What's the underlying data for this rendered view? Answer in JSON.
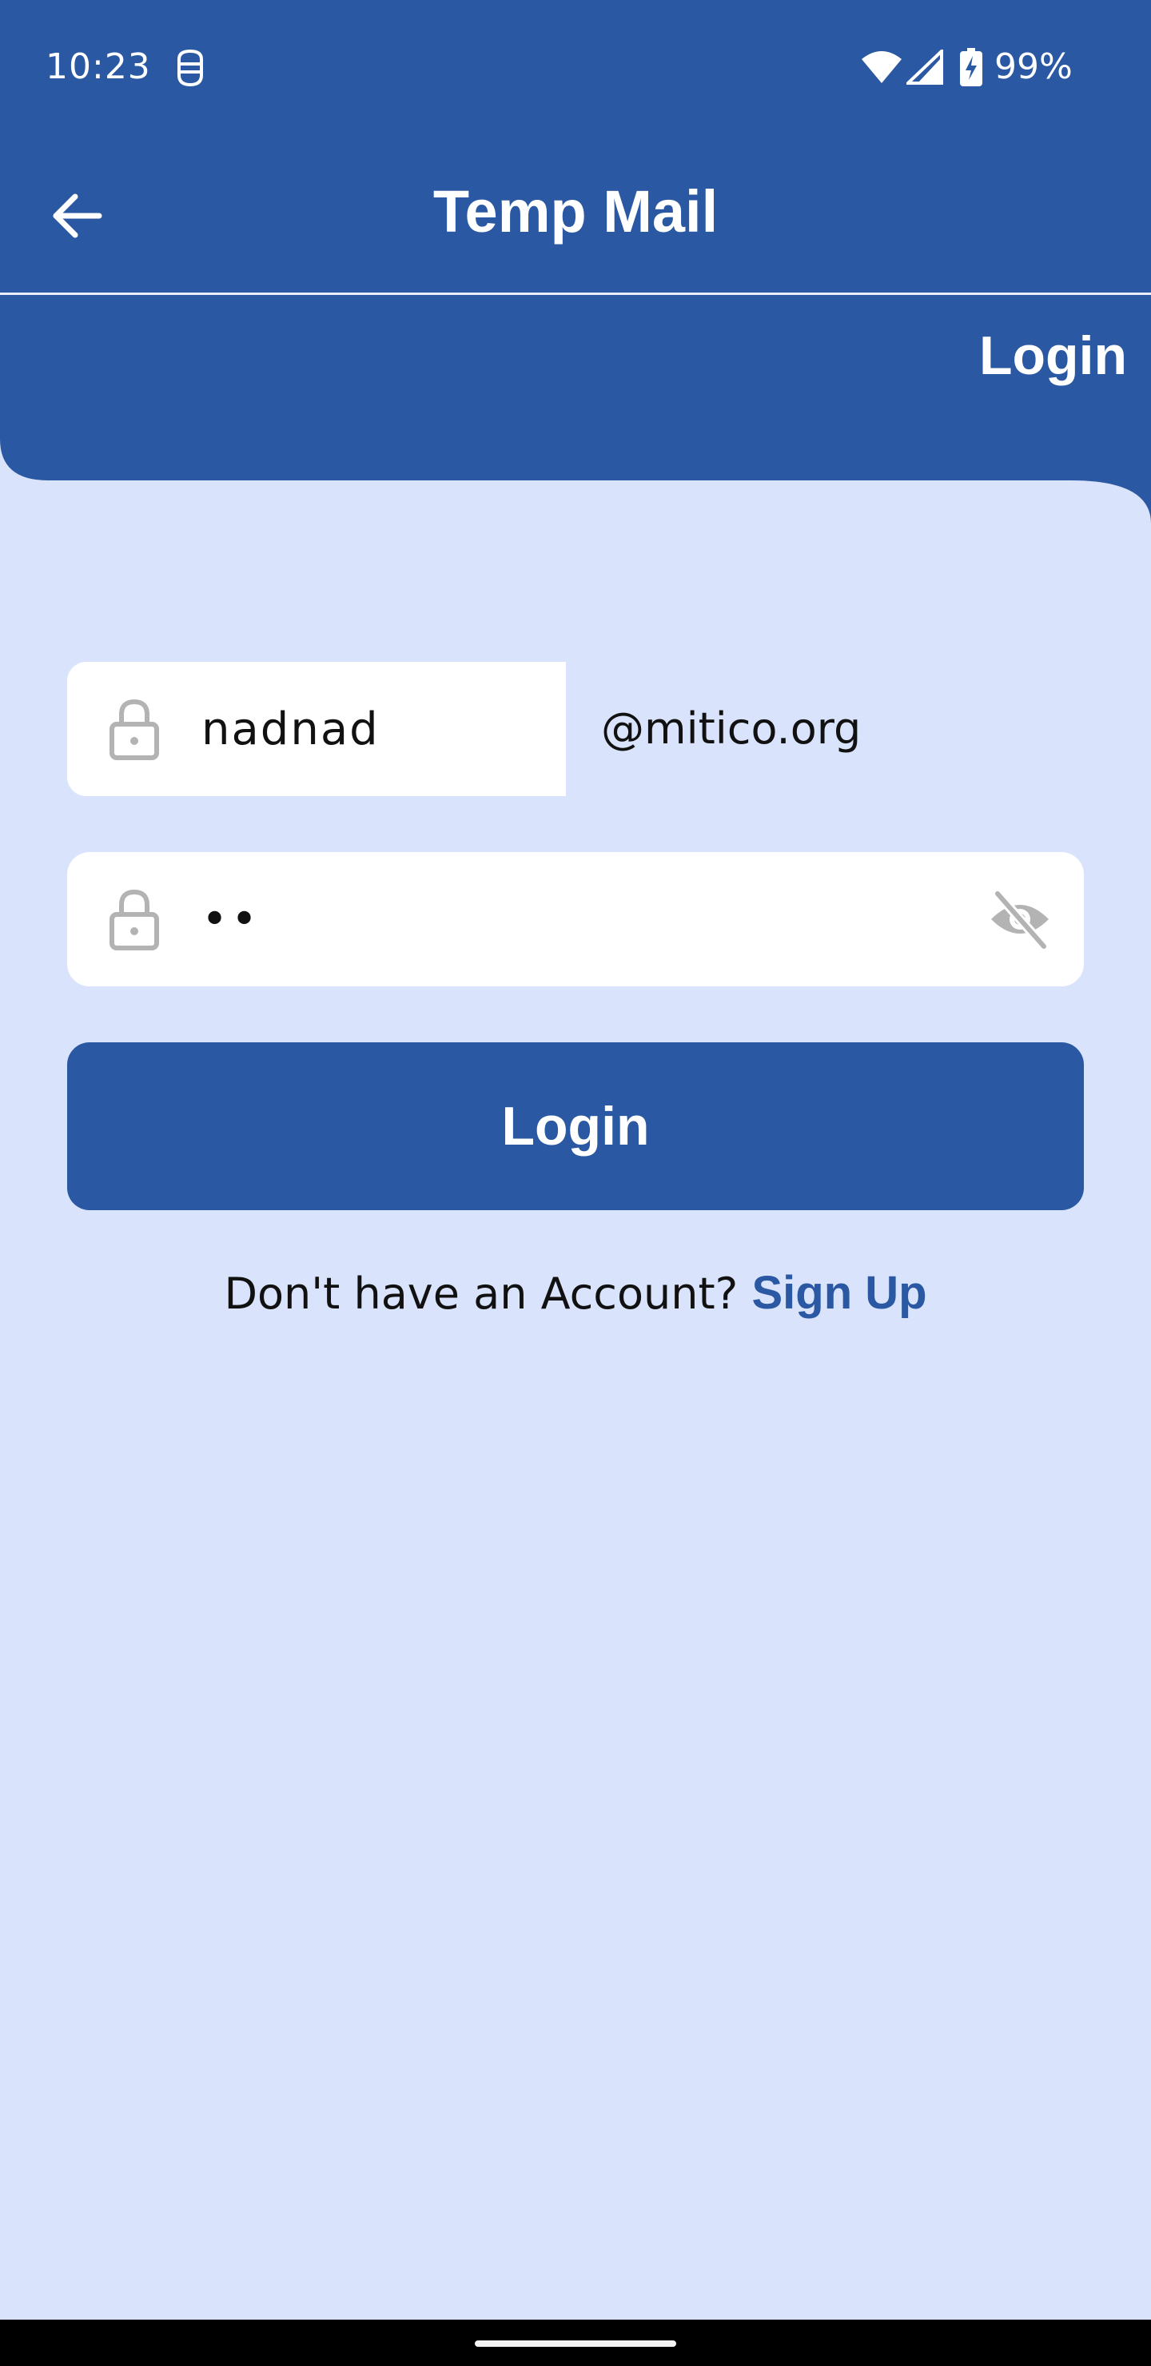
{
  "status_bar": {
    "time": "10:23",
    "battery_percent": "99%",
    "icons": [
      "robot-icon",
      "wifi-icon",
      "signal-icon",
      "battery-charging-icon"
    ]
  },
  "app_bar": {
    "title": "Temp Mail",
    "back_icon": "arrow-left-icon"
  },
  "header": {
    "label": "Login"
  },
  "form": {
    "username": {
      "value": "nadnad",
      "domain": "@mitico.org",
      "icon": "lock-icon"
    },
    "password": {
      "value": "••",
      "icon": "lock-icon",
      "toggle_icon": "eye-off-icon"
    },
    "login_button": "Login",
    "signup_prompt": "Don't have an Account?",
    "signup_link": "Sign Up"
  },
  "colors": {
    "primary": "#2a58a2",
    "background": "#d9e4fc",
    "field_background": "#ffffff",
    "icon_gray": "#b3b3b3"
  }
}
